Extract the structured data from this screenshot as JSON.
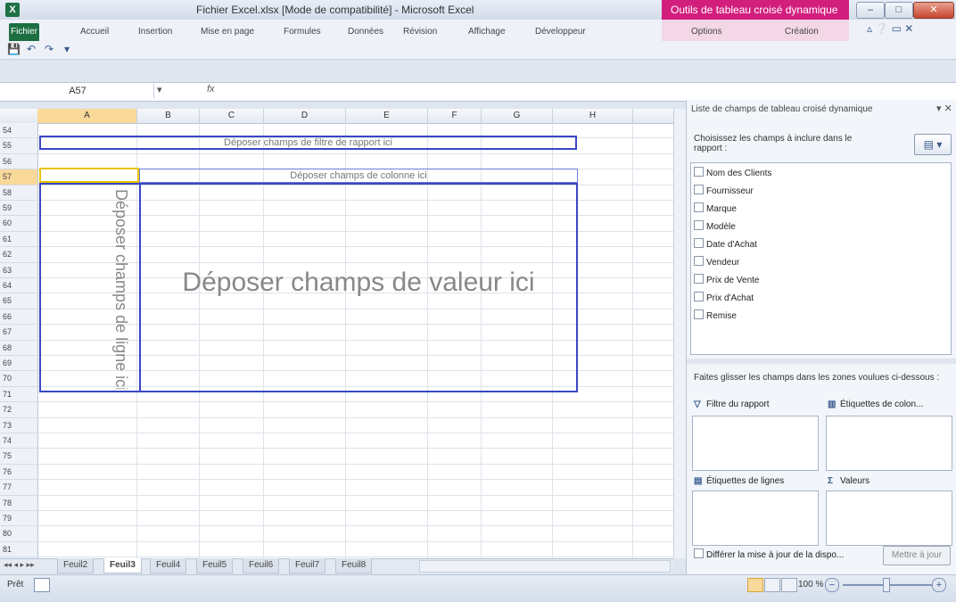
{
  "window": {
    "title": "Fichier Excel.xlsx [Mode de compatibilité] - Microsoft Excel",
    "context_tab_group": "Outils de tableau croisé dynamique",
    "controls": {
      "minimize": "–",
      "maximize": "□",
      "close": "✕"
    }
  },
  "ribbon": {
    "file_tab": "Fichier",
    "tabs": [
      "Accueil",
      "Insertion",
      "Mise en page",
      "Formules",
      "Données",
      "Révision",
      "Affichage",
      "Développeur"
    ],
    "context_tabs": [
      "Options",
      "Création"
    ],
    "help_icons": "▵ ❔ ▭ ✕"
  },
  "qat": {
    "save": "💾",
    "undo": "↶",
    "redo": "↷",
    "customize": "▾"
  },
  "formula_bar": {
    "name_box": "A57",
    "fx": "fx",
    "formula": ""
  },
  "grid": {
    "columns": [
      "A",
      "B",
      "C",
      "D",
      "E",
      "F",
      "G",
      "H"
    ],
    "selected_column": "A",
    "rows": [
      "54",
      "55",
      "56",
      "57",
      "58",
      "59",
      "60",
      "61",
      "62",
      "63",
      "64",
      "65",
      "66",
      "67",
      "68",
      "69",
      "70",
      "71",
      "72",
      "73",
      "74",
      "75",
      "76",
      "77",
      "78",
      "79",
      "80",
      "81"
    ],
    "selected_row": "57"
  },
  "pivot_zones": {
    "report_filter": "Déposer champs de filtre de rapport ici",
    "columns": "Déposer champs de colonne ici",
    "rows": "Déposer champs de ligne ici",
    "values": "Déposer champs de valeur ici"
  },
  "sheet_tabs": {
    "nav": "◂◂ ◂ ▸ ▸▸",
    "tabs": [
      "Feuil2",
      "Feuil3",
      "Feuil4",
      "Feuil5",
      "Feuil6",
      "Feuil7",
      "Feuil8"
    ],
    "active_index": 1
  },
  "pivot_pane": {
    "title": "Liste de champs de tableau croisé dynamique",
    "close": "▾ ✕",
    "instruction": "Choisissez les champs à inclure dans le rapport :",
    "layout_button": "▤ ▾",
    "fields": [
      "Nom des Clients",
      "Fournisseur",
      "Marque",
      "Modèle",
      "Date d'Achat",
      "Vendeur",
      "Prix de Vente",
      "Prix d'Achat",
      "Remise"
    ],
    "drag_instruction": "Faites glisser les champs dans les zones voulues ci-dessous :",
    "areas": {
      "filter": "Filtre du rapport",
      "columns": "Étiquettes de colon...",
      "rows": "Étiquettes de lignes",
      "values": "Valeurs"
    },
    "area_icons": {
      "filter": "▽",
      "columns": "▥",
      "rows": "▤",
      "values": "Σ"
    },
    "defer_label": "Différer la mise à jour de la dispo...",
    "update_button": "Mettre à jour"
  },
  "status_bar": {
    "ready": "Prêt",
    "zoom": "100 %",
    "zoom_out": "−",
    "zoom_in": "+"
  },
  "colors": {
    "excel_green": "#1d6f42",
    "context_pink": "#d21f7e",
    "zone_blue": "#3a46c4",
    "selection_gold": "#f9d99a"
  }
}
